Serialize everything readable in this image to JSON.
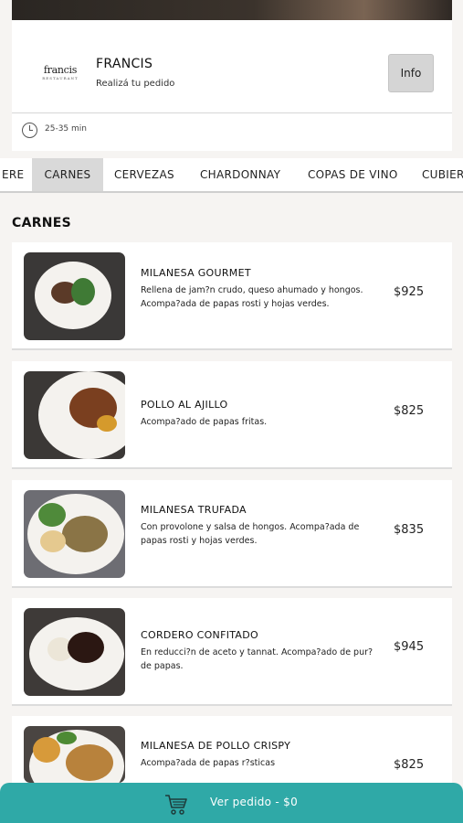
{
  "restaurant": {
    "logo_text": "francis",
    "logo_sub": "RESTAURANT",
    "name": "FRANCIS",
    "subtitle": "Realizá tu pedido",
    "info_label": "Info",
    "eta": "25-35 min"
  },
  "tabs": [
    {
      "label": "ERE",
      "active": false
    },
    {
      "label": "CARNES",
      "active": true
    },
    {
      "label": "CERVEZAS",
      "active": false
    },
    {
      "label": "CHARDONNAY",
      "active": false
    },
    {
      "label": "COPAS DE VINO",
      "active": false
    },
    {
      "label": "CUBIER",
      "active": false
    }
  ],
  "section": {
    "title": "CARNES"
  },
  "items": [
    {
      "name": "MILANESA GOURMET",
      "description": "Rellena de jam?n crudo, queso ahumado y hongos. Acompa?ada de papas rosti y hojas verdes.",
      "price": "$925"
    },
    {
      "name": "POLLO AL AJILLO",
      "description": "Acompa?ado de papas fritas.",
      "price": "$825"
    },
    {
      "name": "MILANESA TRUFADA",
      "description": "Con provolone y salsa de hongos. Acompa?ada de papas rosti y  hojas verdes.",
      "price": "$835"
    },
    {
      "name": "CORDERO CONFITADO",
      "description": "En reducci?n de aceto y tannat. Acompa?ado de pur? de papas.",
      "price": "$945"
    },
    {
      "name": "MILANESA DE POLLO CRISPY",
      "description": "Acompa?ada de papas r?sticas",
      "price": "$825"
    }
  ],
  "cart": {
    "label": "Ver pedido - $0",
    "icon": "cart-icon"
  },
  "colors": {
    "accent": "#2fa9a7",
    "active_tab": "#d9d9d9"
  }
}
